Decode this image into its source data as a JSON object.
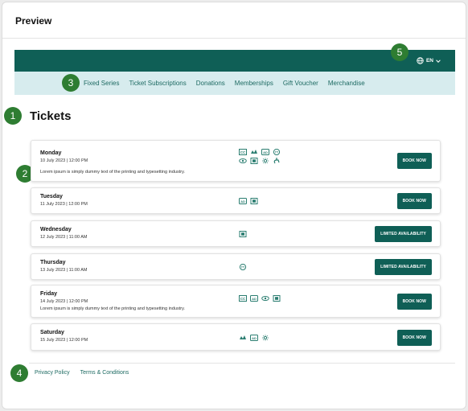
{
  "panel": {
    "title": "Preview"
  },
  "header": {
    "language": "EN",
    "nav": [
      "Fixed Series",
      "Ticket Subscriptions",
      "Donations",
      "Memberships",
      "Gift Voucher",
      "Merchandise"
    ]
  },
  "badges": [
    "1",
    "2",
    "3",
    "4",
    "5"
  ],
  "page": {
    "heading": "Tickets"
  },
  "tickets": [
    {
      "day": "Monday",
      "date": "10 July 2023 | 12:00 PM",
      "description": "Lorem ipsum is simply dummy text of the printing and typesetting industry.",
      "icons": [
        "cc-icon",
        "sign-language-icon",
        "audio-description-icon",
        "tt-icon",
        "eye-icon",
        "qr-icon",
        "relaxed-icon",
        "wheelchair-icon"
      ],
      "button": "BOOK NOW"
    },
    {
      "day": "Tuesday",
      "date": "11 July 2023 | 12:00 PM",
      "description": "",
      "icons": [
        "audio-description-icon",
        "qr-icon"
      ],
      "button": "BOOK NOW"
    },
    {
      "day": "Wednesday",
      "date": "12 July 2023 | 11:00 AM",
      "description": "",
      "icons": [
        "qr-icon"
      ],
      "button": "LIMITED AVAILABILITY"
    },
    {
      "day": "Thursday",
      "date": "13 July 2023 | 11:00 AM",
      "description": "",
      "icons": [
        "tt-icon"
      ],
      "button": "LIMITED AVAILABILITY"
    },
    {
      "day": "Friday",
      "date": "14 July 2023 | 12:00 PM",
      "description": "Lorem ipsum is simply dummy text of the printing and typesetting industry.",
      "icons": [
        "cc-icon",
        "audio-description-icon",
        "eye-icon",
        "qr-icon"
      ],
      "button": "BOOK NOW"
    },
    {
      "day": "Saturday",
      "date": "15 July 2023 | 12:00 PM",
      "description": "",
      "icons": [
        "sign-language-icon",
        "audio-description-icon",
        "relaxed-icon"
      ],
      "button": "BOOK NOW"
    }
  ],
  "footer": {
    "links": [
      "Privacy Policy",
      "Terms & Conditions"
    ]
  },
  "colors": {
    "primary": "#0f5f56",
    "subnav": "#d7ecee",
    "badge": "#2e7d32",
    "link": "#1d6a62"
  }
}
